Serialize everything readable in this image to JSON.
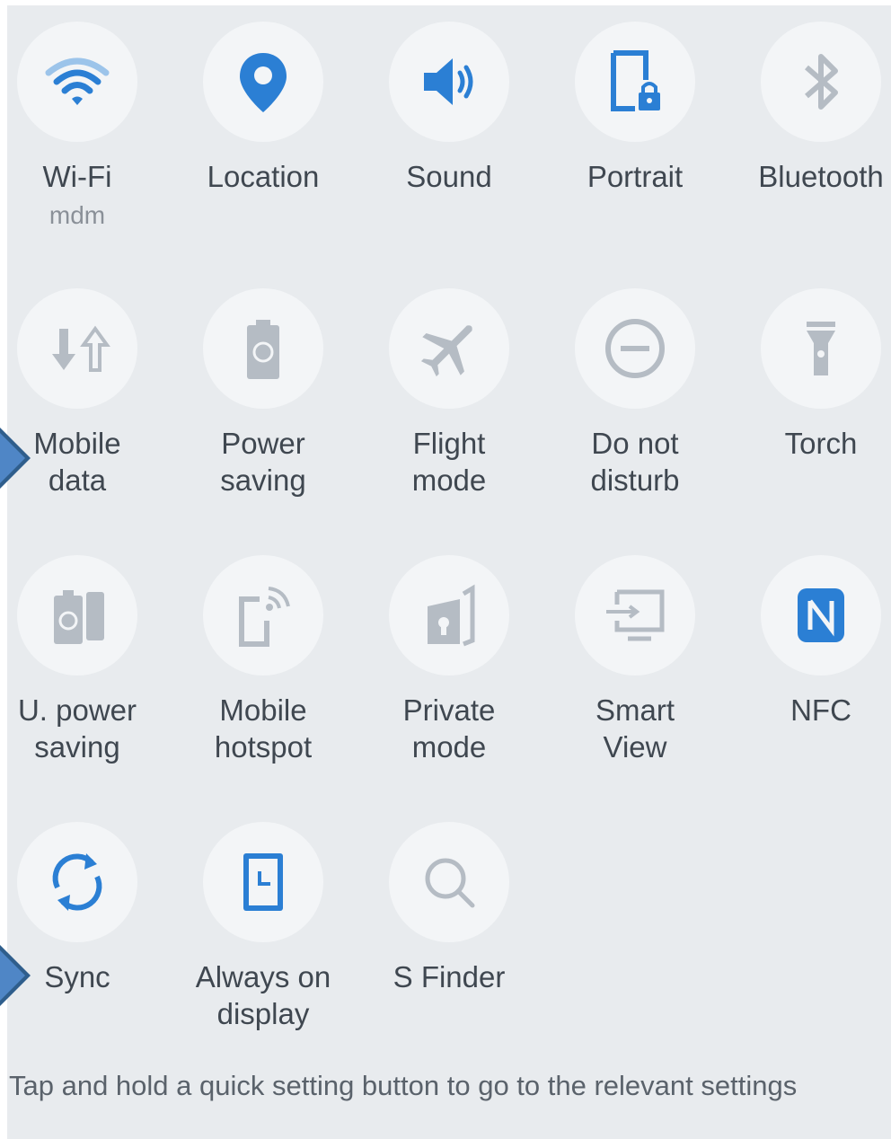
{
  "colors": {
    "active": "#2b7fd4",
    "inactive": "#b5bcc4",
    "background": "#e8ebee"
  },
  "tiles": [
    {
      "label": "Wi-Fi",
      "sublabel": "mdm",
      "icon": "wifi-icon",
      "state": "on"
    },
    {
      "label": "Location",
      "icon": "location-pin-icon",
      "state": "on"
    },
    {
      "label": "Sound",
      "icon": "sound-icon",
      "state": "on"
    },
    {
      "label": "Portrait",
      "icon": "portrait-lock-icon",
      "state": "on"
    },
    {
      "label": "Bluetooth",
      "icon": "bluetooth-icon",
      "state": "off"
    },
    {
      "label": "Mobile\ndata",
      "icon": "mobile-data-icon",
      "state": "off"
    },
    {
      "label": "Power\nsaving",
      "icon": "power-saving-icon",
      "state": "off"
    },
    {
      "label": "Flight\nmode",
      "icon": "airplane-icon",
      "state": "off"
    },
    {
      "label": "Do not\ndisturb",
      "icon": "do-not-disturb-icon",
      "state": "off"
    },
    {
      "label": "Torch",
      "icon": "torch-icon",
      "state": "off"
    },
    {
      "label": "U. power\nsaving",
      "icon": "ultra-power-saving-icon",
      "state": "off"
    },
    {
      "label": "Mobile\nhotspot",
      "icon": "hotspot-icon",
      "state": "off"
    },
    {
      "label": "Private\nmode",
      "icon": "private-mode-icon",
      "state": "off"
    },
    {
      "label": "Smart\nView",
      "icon": "smart-view-icon",
      "state": "off"
    },
    {
      "label": "NFC",
      "icon": "nfc-icon",
      "state": "on"
    },
    {
      "label": "Sync",
      "icon": "sync-icon",
      "state": "on"
    },
    {
      "label": "Always on\ndisplay",
      "icon": "always-on-display-icon",
      "state": "on"
    },
    {
      "label": "S Finder",
      "icon": "search-icon",
      "state": "off"
    }
  ],
  "hint": "Tap and hold a quick setting button to go to the relevant settings"
}
